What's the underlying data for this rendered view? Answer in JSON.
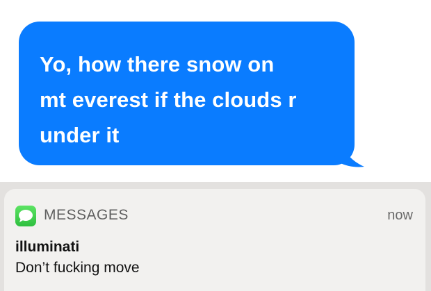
{
  "imessage": {
    "bubble_text": "Yo, how there snow on\nmt everest if the clouds r\nunder it",
    "bubble_color": "#0a7cff"
  },
  "notification": {
    "app_icon": "messages-icon",
    "app_name": "MESSAGES",
    "time": "now",
    "sender": "illuminati",
    "message": "Don’t fucking move"
  }
}
